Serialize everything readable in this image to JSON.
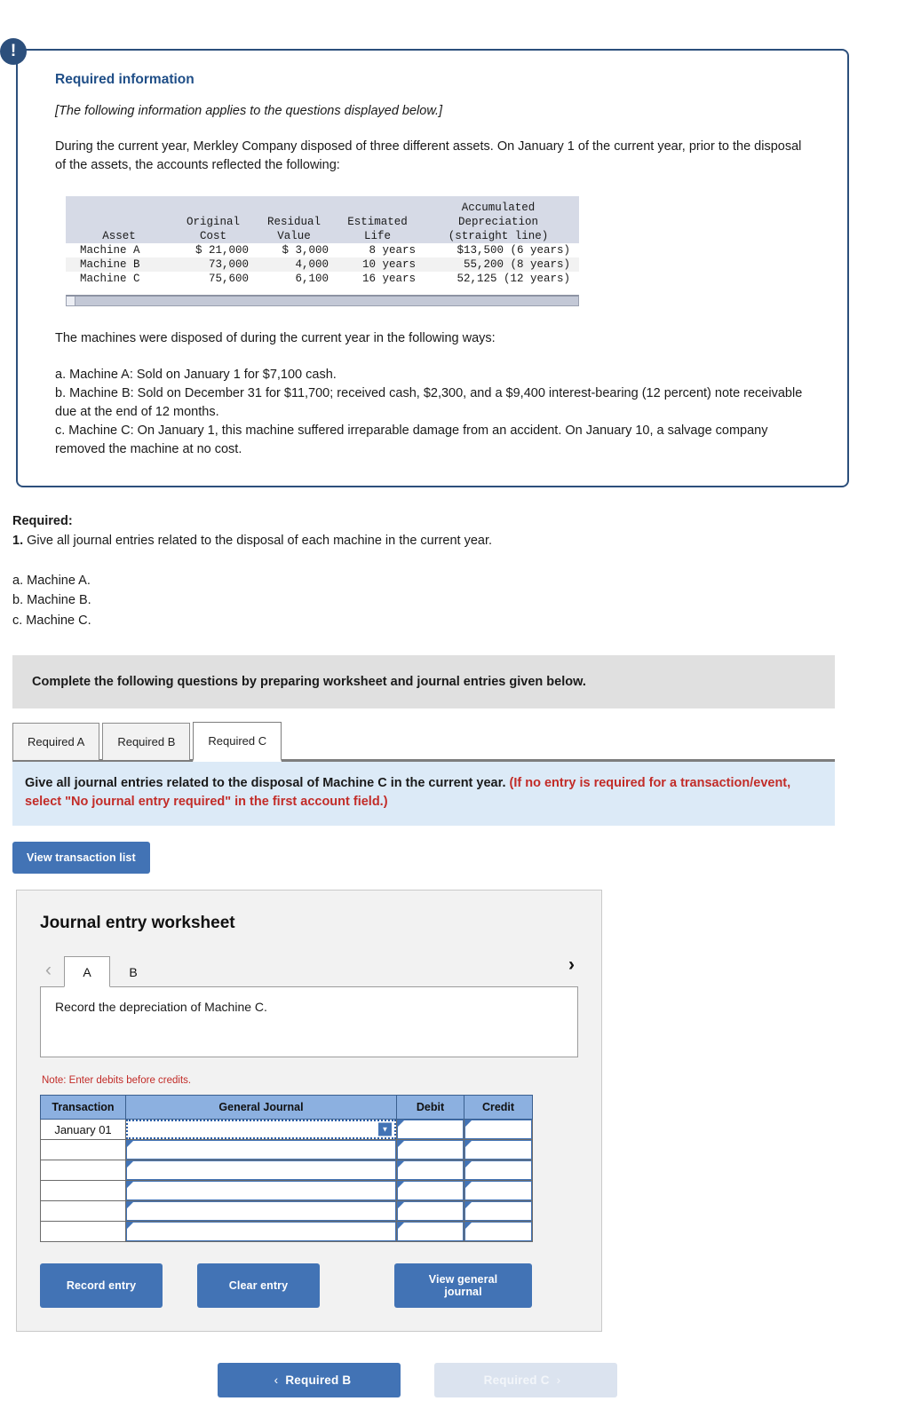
{
  "callout": {
    "alert_icon": "exclamation-icon",
    "title": "Required information",
    "italic_note": "[The following information applies to the questions displayed below.]",
    "intro": "During the current year, Merkley Company disposed of three different assets. On January 1 of the current year, prior to the disposal of the assets, the accounts reflected the following:",
    "asset_table": {
      "headers_line1": [
        "",
        "",
        "",
        "",
        "Accumulated"
      ],
      "headers_line2": [
        "",
        "Original",
        "Residual",
        "Estimated",
        "Depreciation"
      ],
      "headers_line3": [
        "Asset",
        "Cost",
        "Value",
        "Life",
        "(straight line)"
      ],
      "rows": [
        [
          "Machine A",
          "$ 21,000",
          "$ 3,000",
          "8 years",
          "$13,500 (6 years)"
        ],
        [
          "Machine B",
          "73,000",
          "4,000",
          "10 years",
          "55,200 (8 years)"
        ],
        [
          "Machine C",
          "75,600",
          "6,100",
          "16 years",
          "52,125 (12 years)"
        ]
      ]
    },
    "ways_title": "The machines were disposed of during the current year in the following ways:",
    "ways": [
      "a. Machine A: Sold on January 1 for $7,100 cash.",
      "b. Machine B: Sold on December 31 for $11,700; received cash, $2,300, and a $9,400 interest-bearing (12 percent) note receivable due at the end of 12 months.",
      "c. Machine C: On January 1, this machine suffered irreparable damage from an accident. On January 10, a salvage company removed the machine at no cost."
    ]
  },
  "required": {
    "label": "Required:",
    "item_number": "1.",
    "item_text": " Give all journal entries related to the disposal of each machine in the current year.",
    "sub_items": [
      "a. Machine A.",
      "b. Machine B.",
      "c. Machine C."
    ]
  },
  "gray_banner": "Complete the following questions by preparing worksheet and journal entries given below.",
  "tabs": [
    {
      "label": "Required A",
      "active": false
    },
    {
      "label": "Required B",
      "active": false
    },
    {
      "label": "Required C",
      "active": true
    }
  ],
  "blue_strip": {
    "main": "Give all journal entries related to the disposal of Machine C in the current year. ",
    "red": "(If no entry is required for a transaction/event, select \"No journal entry required\" in the first account field.)"
  },
  "view_transaction_list_label": "View transaction list",
  "worksheet": {
    "heading": "Journal entry worksheet",
    "prev_arrow": "‹",
    "next_arrow": "›",
    "entry_tabs": [
      {
        "label": "A",
        "active": true
      },
      {
        "label": "B",
        "active": false
      }
    ],
    "description": "Record the depreciation of Machine C.",
    "note": "Note: Enter debits before credits.",
    "grid": {
      "headers": [
        "Transaction",
        "General Journal",
        "Debit",
        "Credit"
      ],
      "rows": [
        {
          "transaction": "January 01",
          "general_journal": "",
          "debit": "",
          "credit": "",
          "active": true
        },
        {
          "transaction": "",
          "general_journal": "",
          "debit": "",
          "credit": "",
          "active": false
        },
        {
          "transaction": "",
          "general_journal": "",
          "debit": "",
          "credit": "",
          "active": false
        },
        {
          "transaction": "",
          "general_journal": "",
          "debit": "",
          "credit": "",
          "active": false
        },
        {
          "transaction": "",
          "general_journal": "",
          "debit": "",
          "credit": "",
          "active": false
        },
        {
          "transaction": "",
          "general_journal": "",
          "debit": "",
          "credit": "",
          "active": false
        }
      ]
    },
    "buttons": {
      "record": "Record entry",
      "clear": "Clear entry",
      "view_general_journal": "View general journal"
    }
  },
  "pager": {
    "prev_arrow": "‹",
    "prev_label": "Required B",
    "next_label": "Required C",
    "next_arrow": "›"
  },
  "colors": {
    "accent_blue": "#4273b5",
    "callout_border": "#2c4f7c",
    "header_blue": "#8cb0e0",
    "red_note": "#c22c28",
    "banner_gray": "#e0e0e0",
    "strip_blue": "#dceaf7"
  }
}
